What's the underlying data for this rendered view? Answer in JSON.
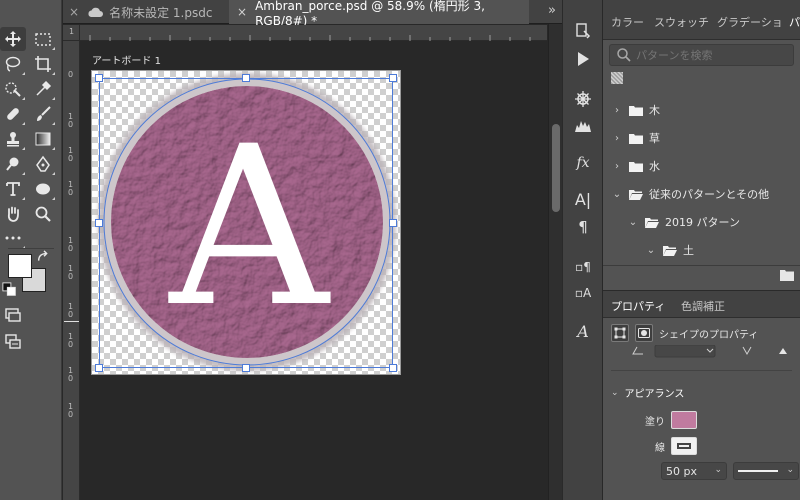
{
  "tabs": {
    "tab1_label": "名称未設定 1.psdc",
    "tab2_label": "Ambran_porce.psd @ 58.9% (楕円形 3, RGB/8#) *",
    "close": "×",
    "more": "»"
  },
  "rulers": {
    "top": [
      "1"
    ],
    "left": [
      "1",
      "0",
      "1",
      "0",
      "1",
      "0",
      "1",
      "0",
      "1",
      "0",
      "1",
      "0",
      "1",
      "0",
      "1",
      "0",
      "1",
      "0",
      "1",
      "0"
    ]
  },
  "canvas": {
    "artboard_label": "アートボード 1",
    "letter": "A",
    "circle_color": "#a9688f",
    "ring_color": "#c9c0c5"
  },
  "panels": {
    "top_tabs": [
      "カラー",
      "スウォッチ",
      "グラデーショ",
      "パ"
    ],
    "search_placeholder": "パターンを検索",
    "tree": [
      {
        "label": "木",
        "expanded": false,
        "indent": 0
      },
      {
        "label": "草",
        "expanded": false,
        "indent": 0
      },
      {
        "label": "水",
        "expanded": false,
        "indent": 0
      },
      {
        "label": "従来のパターンとその他",
        "expanded": true,
        "indent": 0
      },
      {
        "label": "2019 パターン",
        "expanded": true,
        "indent": 1
      },
      {
        "label": "土",
        "expanded": true,
        "indent": 2
      }
    ]
  },
  "properties": {
    "tabs": [
      "プロパティ",
      "色調補正"
    ],
    "shape_props_label": "シェイプのプロパティ",
    "appearance_label": "アピアランス",
    "fill_label": "塗り",
    "fill_color": "#c07b9f",
    "stroke_label": "線",
    "stroke_width": "50 px"
  },
  "colors": {
    "selection": "#4d7bd8",
    "foreground": "#ffffff",
    "background": "#d9d9d9"
  }
}
